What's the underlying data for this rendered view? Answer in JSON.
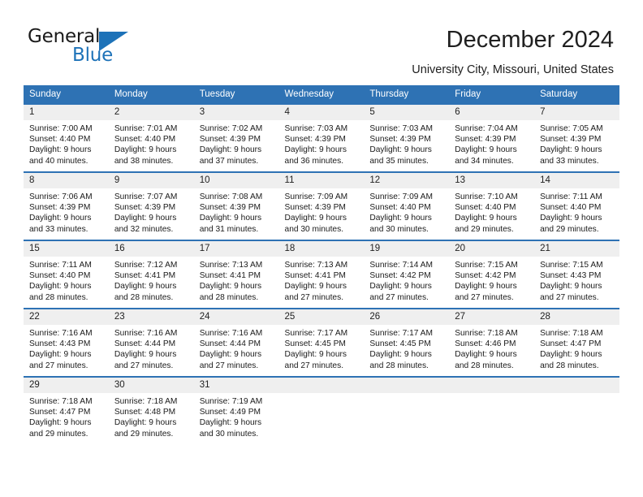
{
  "brand": {
    "name_part1": "General",
    "name_part2": "Blue",
    "accent_color": "#1d72b8"
  },
  "header": {
    "title": "December 2024",
    "subtitle": "University City, Missouri, United States",
    "header_bg_color": "#2e72b4",
    "daynum_bg_color": "#efefef"
  },
  "weekdays": [
    "Sunday",
    "Monday",
    "Tuesday",
    "Wednesday",
    "Thursday",
    "Friday",
    "Saturday"
  ],
  "labels": {
    "sunrise_prefix": "Sunrise:",
    "sunset_prefix": "Sunset:",
    "daylight_prefix": "Daylight:"
  },
  "weeks": [
    [
      {
        "day": "1",
        "sunrise": "Sunrise: 7:00 AM",
        "sunset": "Sunset: 4:40 PM",
        "daylight_line1": "Daylight: 9 hours",
        "daylight_line2": "and 40 minutes."
      },
      {
        "day": "2",
        "sunrise": "Sunrise: 7:01 AM",
        "sunset": "Sunset: 4:40 PM",
        "daylight_line1": "Daylight: 9 hours",
        "daylight_line2": "and 38 minutes."
      },
      {
        "day": "3",
        "sunrise": "Sunrise: 7:02 AM",
        "sunset": "Sunset: 4:39 PM",
        "daylight_line1": "Daylight: 9 hours",
        "daylight_line2": "and 37 minutes."
      },
      {
        "day": "4",
        "sunrise": "Sunrise: 7:03 AM",
        "sunset": "Sunset: 4:39 PM",
        "daylight_line1": "Daylight: 9 hours",
        "daylight_line2": "and 36 minutes."
      },
      {
        "day": "5",
        "sunrise": "Sunrise: 7:03 AM",
        "sunset": "Sunset: 4:39 PM",
        "daylight_line1": "Daylight: 9 hours",
        "daylight_line2": "and 35 minutes."
      },
      {
        "day": "6",
        "sunrise": "Sunrise: 7:04 AM",
        "sunset": "Sunset: 4:39 PM",
        "daylight_line1": "Daylight: 9 hours",
        "daylight_line2": "and 34 minutes."
      },
      {
        "day": "7",
        "sunrise": "Sunrise: 7:05 AM",
        "sunset": "Sunset: 4:39 PM",
        "daylight_line1": "Daylight: 9 hours",
        "daylight_line2": "and 33 minutes."
      }
    ],
    [
      {
        "day": "8",
        "sunrise": "Sunrise: 7:06 AM",
        "sunset": "Sunset: 4:39 PM",
        "daylight_line1": "Daylight: 9 hours",
        "daylight_line2": "and 33 minutes."
      },
      {
        "day": "9",
        "sunrise": "Sunrise: 7:07 AM",
        "sunset": "Sunset: 4:39 PM",
        "daylight_line1": "Daylight: 9 hours",
        "daylight_line2": "and 32 minutes."
      },
      {
        "day": "10",
        "sunrise": "Sunrise: 7:08 AM",
        "sunset": "Sunset: 4:39 PM",
        "daylight_line1": "Daylight: 9 hours",
        "daylight_line2": "and 31 minutes."
      },
      {
        "day": "11",
        "sunrise": "Sunrise: 7:09 AM",
        "sunset": "Sunset: 4:39 PM",
        "daylight_line1": "Daylight: 9 hours",
        "daylight_line2": "and 30 minutes."
      },
      {
        "day": "12",
        "sunrise": "Sunrise: 7:09 AM",
        "sunset": "Sunset: 4:40 PM",
        "daylight_line1": "Daylight: 9 hours",
        "daylight_line2": "and 30 minutes."
      },
      {
        "day": "13",
        "sunrise": "Sunrise: 7:10 AM",
        "sunset": "Sunset: 4:40 PM",
        "daylight_line1": "Daylight: 9 hours",
        "daylight_line2": "and 29 minutes."
      },
      {
        "day": "14",
        "sunrise": "Sunrise: 7:11 AM",
        "sunset": "Sunset: 4:40 PM",
        "daylight_line1": "Daylight: 9 hours",
        "daylight_line2": "and 29 minutes."
      }
    ],
    [
      {
        "day": "15",
        "sunrise": "Sunrise: 7:11 AM",
        "sunset": "Sunset: 4:40 PM",
        "daylight_line1": "Daylight: 9 hours",
        "daylight_line2": "and 28 minutes."
      },
      {
        "day": "16",
        "sunrise": "Sunrise: 7:12 AM",
        "sunset": "Sunset: 4:41 PM",
        "daylight_line1": "Daylight: 9 hours",
        "daylight_line2": "and 28 minutes."
      },
      {
        "day": "17",
        "sunrise": "Sunrise: 7:13 AM",
        "sunset": "Sunset: 4:41 PM",
        "daylight_line1": "Daylight: 9 hours",
        "daylight_line2": "and 28 minutes."
      },
      {
        "day": "18",
        "sunrise": "Sunrise: 7:13 AM",
        "sunset": "Sunset: 4:41 PM",
        "daylight_line1": "Daylight: 9 hours",
        "daylight_line2": "and 27 minutes."
      },
      {
        "day": "19",
        "sunrise": "Sunrise: 7:14 AM",
        "sunset": "Sunset: 4:42 PM",
        "daylight_line1": "Daylight: 9 hours",
        "daylight_line2": "and 27 minutes."
      },
      {
        "day": "20",
        "sunrise": "Sunrise: 7:15 AM",
        "sunset": "Sunset: 4:42 PM",
        "daylight_line1": "Daylight: 9 hours",
        "daylight_line2": "and 27 minutes."
      },
      {
        "day": "21",
        "sunrise": "Sunrise: 7:15 AM",
        "sunset": "Sunset: 4:43 PM",
        "daylight_line1": "Daylight: 9 hours",
        "daylight_line2": "and 27 minutes."
      }
    ],
    [
      {
        "day": "22",
        "sunrise": "Sunrise: 7:16 AM",
        "sunset": "Sunset: 4:43 PM",
        "daylight_line1": "Daylight: 9 hours",
        "daylight_line2": "and 27 minutes."
      },
      {
        "day": "23",
        "sunrise": "Sunrise: 7:16 AM",
        "sunset": "Sunset: 4:44 PM",
        "daylight_line1": "Daylight: 9 hours",
        "daylight_line2": "and 27 minutes."
      },
      {
        "day": "24",
        "sunrise": "Sunrise: 7:16 AM",
        "sunset": "Sunset: 4:44 PM",
        "daylight_line1": "Daylight: 9 hours",
        "daylight_line2": "and 27 minutes."
      },
      {
        "day": "25",
        "sunrise": "Sunrise: 7:17 AM",
        "sunset": "Sunset: 4:45 PM",
        "daylight_line1": "Daylight: 9 hours",
        "daylight_line2": "and 27 minutes."
      },
      {
        "day": "26",
        "sunrise": "Sunrise: 7:17 AM",
        "sunset": "Sunset: 4:45 PM",
        "daylight_line1": "Daylight: 9 hours",
        "daylight_line2": "and 28 minutes."
      },
      {
        "day": "27",
        "sunrise": "Sunrise: 7:18 AM",
        "sunset": "Sunset: 4:46 PM",
        "daylight_line1": "Daylight: 9 hours",
        "daylight_line2": "and 28 minutes."
      },
      {
        "day": "28",
        "sunrise": "Sunrise: 7:18 AM",
        "sunset": "Sunset: 4:47 PM",
        "daylight_line1": "Daylight: 9 hours",
        "daylight_line2": "and 28 minutes."
      }
    ],
    [
      {
        "day": "29",
        "sunrise": "Sunrise: 7:18 AM",
        "sunset": "Sunset: 4:47 PM",
        "daylight_line1": "Daylight: 9 hours",
        "daylight_line2": "and 29 minutes."
      },
      {
        "day": "30",
        "sunrise": "Sunrise: 7:18 AM",
        "sunset": "Sunset: 4:48 PM",
        "daylight_line1": "Daylight: 9 hours",
        "daylight_line2": "and 29 minutes."
      },
      {
        "day": "31",
        "sunrise": "Sunrise: 7:19 AM",
        "sunset": "Sunset: 4:49 PM",
        "daylight_line1": "Daylight: 9 hours",
        "daylight_line2": "and 30 minutes."
      },
      {
        "day": "",
        "sunrise": "",
        "sunset": "",
        "daylight_line1": "",
        "daylight_line2": ""
      },
      {
        "day": "",
        "sunrise": "",
        "sunset": "",
        "daylight_line1": "",
        "daylight_line2": ""
      },
      {
        "day": "",
        "sunrise": "",
        "sunset": "",
        "daylight_line1": "",
        "daylight_line2": ""
      },
      {
        "day": "",
        "sunrise": "",
        "sunset": "",
        "daylight_line1": "",
        "daylight_line2": ""
      }
    ]
  ]
}
